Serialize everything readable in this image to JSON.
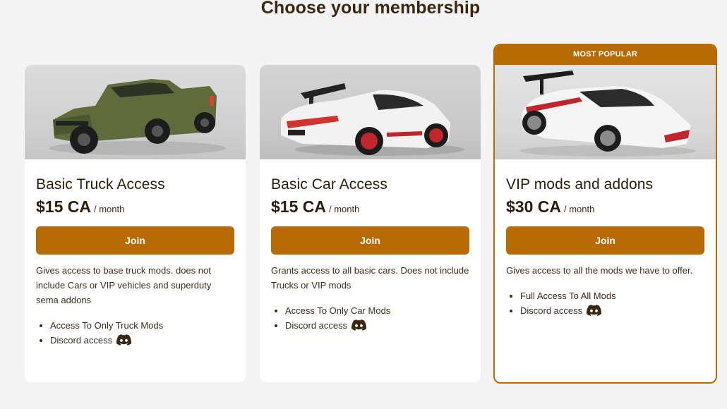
{
  "header": {
    "title": "Choose your membership"
  },
  "colors": {
    "accent": "#b86a05",
    "background": "#f4f4f4",
    "card": "#ffffff",
    "text": "#2b1d0c"
  },
  "plans": [
    {
      "title": "Basic Truck Access",
      "price": "$15 CA",
      "period": "/ month",
      "join_label": "Join",
      "description": "Gives access to base truck mods. does not include Cars or VIP vehicles and superduty sema addons",
      "features": [
        {
          "label": "Access To Only Truck Mods",
          "icon": ""
        },
        {
          "label": "Discord access",
          "icon": "discord-icon"
        }
      ],
      "image": "green-pickup-truck"
    },
    {
      "title": "Basic Car Access",
      "price": "$15 CA",
      "period": "/ month",
      "join_label": "Join",
      "description": "Grants access to all basic cars. Does not include Trucks or VIP mods",
      "features": [
        {
          "label": "Access To Only Car Mods",
          "icon": ""
        },
        {
          "label": "Discord access",
          "icon": "discord-icon"
        }
      ],
      "image": "white-sports-car"
    },
    {
      "badge": "MOST POPULAR",
      "title": "VIP mods and addons",
      "price": "$30 CA",
      "period": "/ month",
      "join_label": "Join",
      "description": "Gives access to all the mods we have to offer.",
      "features": [
        {
          "label": "Full Access To All Mods",
          "icon": ""
        },
        {
          "label": "Discord access",
          "icon": "discord-icon"
        }
      ],
      "image": "white-hypercar"
    }
  ]
}
